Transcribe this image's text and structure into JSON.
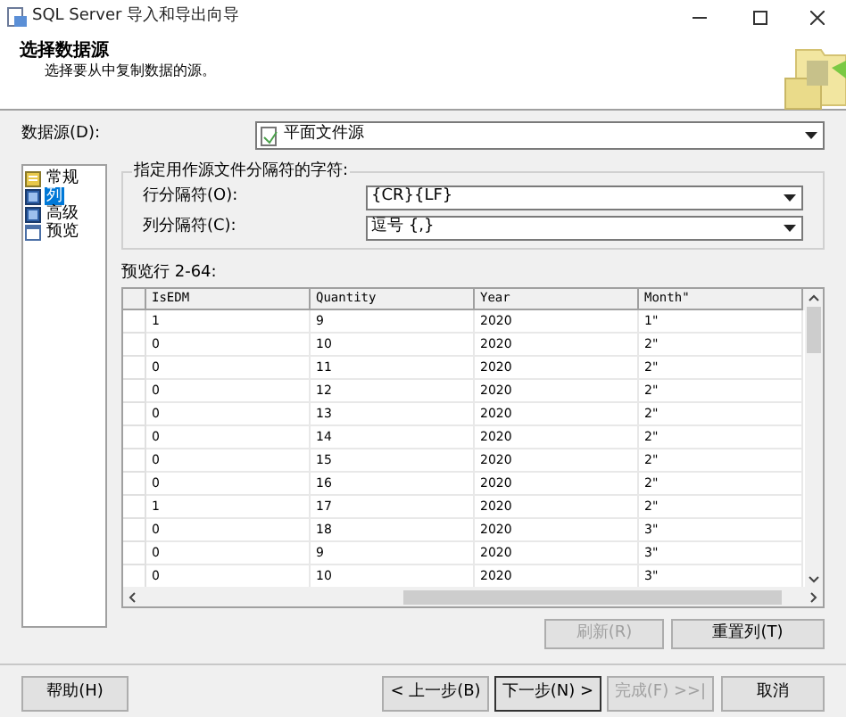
{
  "window": {
    "title": "SQL Server 导入和导出向导"
  },
  "header": {
    "title": "选择数据源",
    "subtitle": "选择要从中复制数据的源。"
  },
  "data_source": {
    "label": "数据源(D):",
    "value": "平面文件源"
  },
  "sidebar": {
    "items": [
      {
        "label": "常规",
        "selected": false
      },
      {
        "label": "列",
        "selected": true
      },
      {
        "label": "高级",
        "selected": false
      },
      {
        "label": "预览",
        "selected": false
      }
    ]
  },
  "delimiters": {
    "legend": "指定用作源文件分隔符的字符:",
    "fields": [
      {
        "label": "行分隔符(O):",
        "value": "{CR}{LF}"
      },
      {
        "label": "列分隔符(C):",
        "value": "逗号 {,}"
      }
    ]
  },
  "preview": {
    "label": "预览行 2-64:",
    "columns": [
      "IsEDM",
      "Quantity",
      "Year",
      "Month\""
    ],
    "rows": [
      [
        "1",
        "9",
        "2020",
        "1\""
      ],
      [
        "0",
        "10",
        "2020",
        "2\""
      ],
      [
        "0",
        "11",
        "2020",
        "2\""
      ],
      [
        "0",
        "12",
        "2020",
        "2\""
      ],
      [
        "0",
        "13",
        "2020",
        "2\""
      ],
      [
        "0",
        "14",
        "2020",
        "2\""
      ],
      [
        "0",
        "15",
        "2020",
        "2\""
      ],
      [
        "0",
        "16",
        "2020",
        "2\""
      ],
      [
        "1",
        "17",
        "2020",
        "2\""
      ],
      [
        "0",
        "18",
        "2020",
        "3\""
      ],
      [
        "0",
        "9",
        "2020",
        "3\""
      ],
      [
        "0",
        "10",
        "2020",
        "3\""
      ]
    ]
  },
  "panel_buttons": [
    {
      "label": "刷新(R)",
      "disabled": true
    },
    {
      "label": "重置列(T)",
      "disabled": false
    }
  ],
  "footer_buttons": [
    {
      "label": "帮助(H)",
      "disabled": false,
      "default": false
    },
    {
      "label": "< 上一步(B)",
      "disabled": false,
      "default": false
    },
    {
      "label": "下一步(N) >",
      "disabled": false,
      "default": true
    },
    {
      "label": "完成(F) >>|",
      "disabled": true,
      "default": false
    },
    {
      "label": "取消",
      "disabled": false,
      "default": false
    }
  ]
}
